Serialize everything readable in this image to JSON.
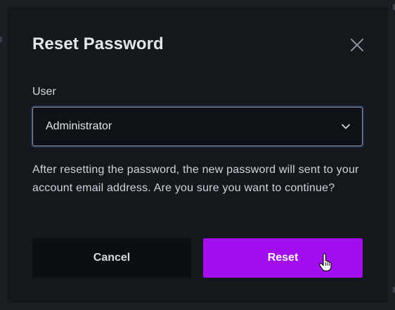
{
  "dialog": {
    "title": "Reset Password",
    "close_icon": "close-icon"
  },
  "user_field": {
    "label": "User",
    "selected_value": "Administrator",
    "dropdown_icon": "chevron-down-icon"
  },
  "message": "After resetting the password, the new password will sent to your account email address. Are you sure you want to continue?",
  "actions": {
    "cancel_label": "Cancel",
    "reset_label": "Reset"
  },
  "colors": {
    "background": "#14171c",
    "accent": "#a20ef0",
    "cancel_bg": "#0b0e12",
    "text": "#e4e6ea"
  },
  "cursor_icon": "hand-pointer-icon"
}
